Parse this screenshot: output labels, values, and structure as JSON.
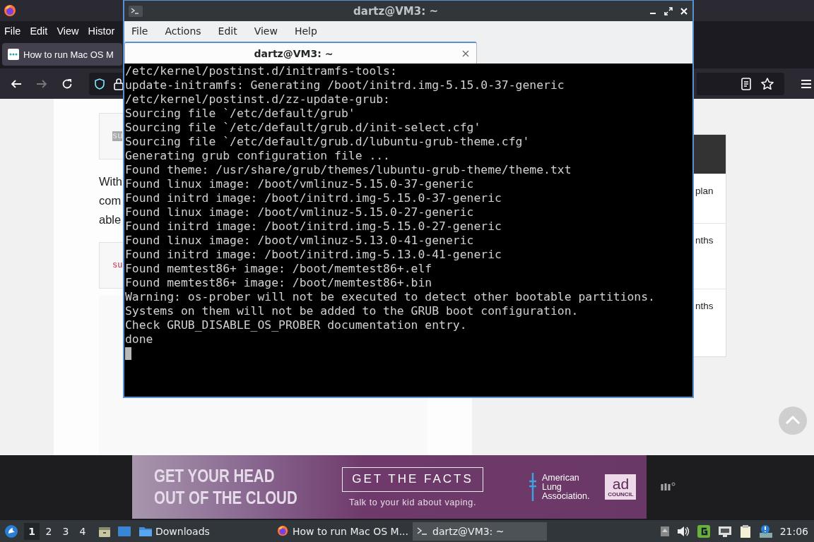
{
  "browser": {
    "menu": [
      "File",
      "Edit",
      "View",
      "Histor"
    ],
    "tabs": [
      {
        "title": "How to run Mac OS M",
        "selected": true
      }
    ],
    "toolbar": [
      {
        "kind": "back",
        "disabled": false
      },
      {
        "kind": "forward",
        "disabled": true
      },
      {
        "kind": "reload",
        "disabled": false
      }
    ],
    "page": {
      "code_blocks": [
        {
          "text": "su",
          "highlighted": true
        },
        {
          "text": "su",
          "highlighted": false
        }
      ],
      "paragraph_lines": [
        "With",
        "com",
        "able"
      ],
      "table_rows": [
        "plan",
        "nths",
        "nths"
      ]
    }
  },
  "ad": {
    "headline": [
      "GET YOUR HEAD",
      "OUT OF THE CLOUD"
    ],
    "button": "GET THE FACTS",
    "tagline": "Talk to your kid about vaping.",
    "sponsor": [
      "American",
      "Lung",
      "Association."
    ],
    "council": [
      "ad",
      "COUNCIL"
    ]
  },
  "terminal": {
    "title": "dartz@VM3: ~",
    "menu": [
      "File",
      "Actions",
      "Edit",
      "View",
      "Help"
    ],
    "tabs": [
      {
        "label": "dartz@VM3: ~",
        "selected": true
      }
    ],
    "lines": [
      "/etc/kernel/postinst.d/initramfs-tools:",
      "update-initramfs: Generating /boot/initrd.img-5.15.0-37-generic",
      "/etc/kernel/postinst.d/zz-update-grub:",
      "Sourcing file `/etc/default/grub'",
      "Sourcing file `/etc/default/grub.d/init-select.cfg'",
      "Sourcing file `/etc/default/grub.d/lubuntu-grub-theme.cfg'",
      "Generating grub configuration file ...",
      "Found theme: /usr/share/grub/themes/lubuntu-grub-theme/theme.txt",
      "Found linux image: /boot/vmlinuz-5.15.0-37-generic",
      "Found initrd image: /boot/initrd.img-5.15.0-37-generic",
      "Found linux image: /boot/vmlinuz-5.15.0-27-generic",
      "Found initrd image: /boot/initrd.img-5.15.0-27-generic",
      "Found linux image: /boot/vmlinuz-5.13.0-41-generic",
      "Found initrd image: /boot/initrd.img-5.13.0-41-generic",
      "Found memtest86+ image: /boot/memtest86+.elf",
      "Found memtest86+ image: /boot/memtest86+.bin",
      "Warning: os-prober will not be executed to detect other bootable partitions.",
      "Systems on them will not be added to the GRUB boot configuration.",
      "Check GRUB_DISABLE_OS_PROBER documentation entry.",
      "done"
    ]
  },
  "taskbar": {
    "workspaces": [
      {
        "label": "1",
        "selected": true
      },
      {
        "label": "2",
        "selected": false
      },
      {
        "label": "3",
        "selected": false
      },
      {
        "label": "4",
        "selected": false
      }
    ],
    "tasks": [
      {
        "kind": "folder",
        "label": "Downloads",
        "selected": false
      },
      {
        "kind": "firefox",
        "label": "How to run Mac OS M...",
        "selected": false
      },
      {
        "kind": "terminal",
        "label": "dartz@VM3: ~",
        "selected": true
      }
    ],
    "clock": "21:06"
  }
}
